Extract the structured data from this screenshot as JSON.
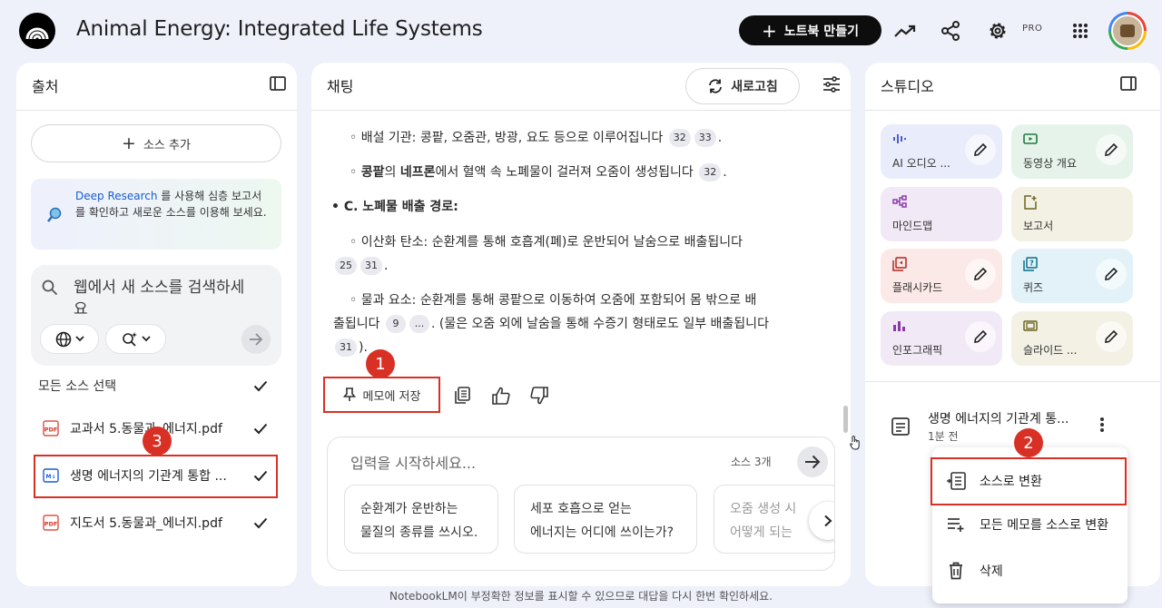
{
  "header": {
    "title": "Animal Energy: Integrated Life Systems",
    "create_notebook_label": "노트북 만들기",
    "pro_badge": "PRO"
  },
  "sources": {
    "panel_title": "출처",
    "add_source_label": "소스 추가",
    "deep_research": {
      "link_text": "Deep Research",
      "text": " 를 사용해 심층 보고서를 확인하고 새로운 소스를 이용해 보세요."
    },
    "search_placeholder": "웹에서 새 소스를 검색하세요",
    "select_all_label": "모든 소스 선택",
    "items": [
      {
        "name": "교과서 5.동물과_에너지.pdf",
        "type": "pdf",
        "checked": true
      },
      {
        "name": "생명 에너지의 기관계 통합 ...",
        "type": "note",
        "checked": true
      },
      {
        "name": "지도서 5.동물과_에너지.pdf",
        "type": "pdf",
        "checked": true
      }
    ]
  },
  "chat": {
    "panel_title": "채팅",
    "refresh_label": "새로고침",
    "lines": {
      "l1_text": "◦ 배설 기관: 콩팥, 오줌관, 방광, 요도 등으로 이루어집니다",
      "l1_cites": [
        "32",
        "33"
      ],
      "l2_bold1": "콩팥",
      "l2_mid1": "의 ",
      "l2_bold2": "네프론",
      "l2_rest": "에서 혈액 속 노폐물이 걸러져 오줌이 생성됩니다",
      "l2_cites": [
        "32"
      ],
      "l3_heading": "• C. 노폐물 배출 경로:",
      "l4_text": "◦ 이산화 탄소: 순환계를 통해 호흡계(폐)로 운반되어 날숨으로 배출됩니다",
      "l4_cites": [
        "25",
        "31"
      ],
      "l5_text": "◦ 물과 요소: 순환계를 통해 콩팥으로 이동하여 오줌에 포함되어 몸 밖으로 배",
      "l6_text": "출됩니다",
      "l6_cites": [
        "9",
        "..."
      ],
      "l6_rest": ". (물은 오줌 외에 날숨을 통해 수증기 형태로도 일부 배출됩니다",
      "l7_cites": [
        "31"
      ],
      "l7_rest": ")."
    },
    "save_to_memo_label": "메모에 저장",
    "input_placeholder": "입력을 시작하세요...",
    "source_count": "소스 3개",
    "suggestions": [
      {
        "line1": "순환계가 운반하는",
        "line2": "물질의 종류를 쓰시오."
      },
      {
        "line1": "세포 호흡으로 얻는",
        "line2": "에너지는 어디에 쓰이는가?"
      },
      {
        "line1": "오줌 생성 시",
        "line2": "어떻게 되는"
      }
    ]
  },
  "studio": {
    "panel_title": "스튜디오",
    "tiles": [
      {
        "label": "AI 오디오 ...",
        "icon": "audio-icon",
        "editable": true
      },
      {
        "label": "동영상 개요",
        "icon": "video-icon",
        "editable": true
      },
      {
        "label": "마인드맵",
        "icon": "mindmap-icon",
        "editable": false
      },
      {
        "label": "보고서",
        "icon": "report-icon",
        "editable": false
      },
      {
        "label": "플래시카드",
        "icon": "flashcard-icon",
        "editable": true
      },
      {
        "label": "퀴즈",
        "icon": "quiz-icon",
        "editable": true
      },
      {
        "label": "인포그래픽",
        "icon": "infographic-icon",
        "editable": true
      },
      {
        "label": "슬라이드 ...",
        "icon": "slides-icon",
        "editable": true
      }
    ],
    "note": {
      "title": "생명 에너지의 기관계 통...",
      "time": "1분 전"
    }
  },
  "context_menu": {
    "items": [
      "소스로 변환",
      "모든 메모를 소스로 변환",
      "삭제"
    ]
  },
  "annotations": {
    "badge1": "1",
    "badge2": "2",
    "badge3": "3"
  },
  "disclaimer": "NotebookLM이 부정확한 정보를 표시할 수 있으므로 대답을 다시 한번 확인하세요.",
  "colors": {
    "accent_red": "#d93025",
    "dark_button": "#0d0d0d",
    "link_blue": "#1a5bd6",
    "background": "#eef0fa"
  }
}
